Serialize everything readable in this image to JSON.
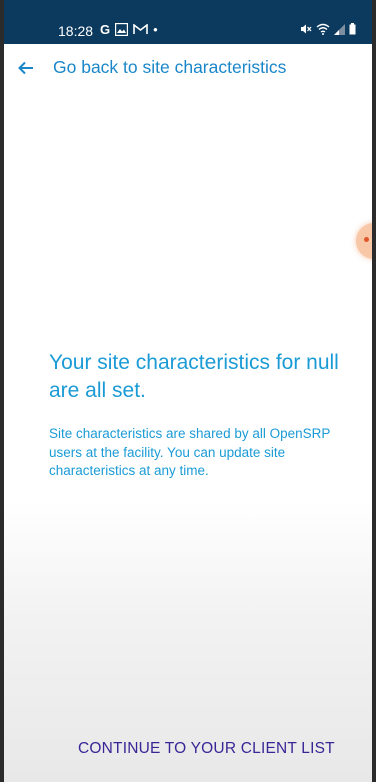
{
  "status_bar": {
    "time": "18:28",
    "left_icons": [
      "google-icon",
      "gallery-icon",
      "gmail-icon",
      "dot-icon"
    ],
    "left_glyphs": {
      "google": "G",
      "dot": "•"
    },
    "right_icons": [
      "mute-icon",
      "wifi-icon",
      "signal-icon",
      "battery-icon"
    ]
  },
  "top_bar": {
    "back_label": "Go back to site characteristics"
  },
  "content": {
    "heading": "Your site characteristics for null are all set.",
    "description": "Site characteristics are shared by all OpenSRP users at the facility. You can update site characteristics at any time."
  },
  "footer": {
    "continue_label": "CONTINUE TO YOUR CLIENT LIST"
  },
  "colors": {
    "status_bar_bg": "#0b3a5e",
    "link_blue": "#1b87c9",
    "text_blue": "#1b9bd6",
    "button_purple": "#3a2596"
  }
}
